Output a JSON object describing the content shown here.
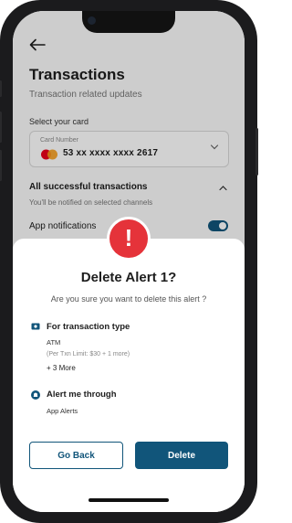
{
  "header": {
    "title": "Transactions",
    "subtitle": "Transaction related updates"
  },
  "card": {
    "section_label": "Select your card",
    "field_label": "Card Number",
    "number": "53 xx xxxx xxxx 2617"
  },
  "section": {
    "title": "All successful transactions",
    "subtitle": "You'll be notified on selected channels"
  },
  "app_notifications": {
    "label": "App notifications",
    "enabled": true
  },
  "modal": {
    "title": "Delete Alert 1?",
    "question": "Are you sure you want to delete this alert ?",
    "transaction_type": {
      "heading": "For transaction type",
      "value": "ATM",
      "detail": "(Per Txn Limit: $30 + 1 more)",
      "more": "+ 3 More"
    },
    "alert_through": {
      "heading": "Alert me through",
      "value": "App Alerts"
    },
    "go_back_label": "Go Back",
    "delete_label": "Delete"
  },
  "colors": {
    "primary": "#11557a",
    "danger": "#e5333a"
  },
  "icons": {
    "back": "back-arrow-icon",
    "card_brand": "mastercard-icon",
    "dropdown": "chevron-down-icon",
    "collapse": "chevron-up-icon",
    "alert": "exclamation-icon",
    "transaction": "money-icon",
    "alert_channel": "bell-icon"
  }
}
